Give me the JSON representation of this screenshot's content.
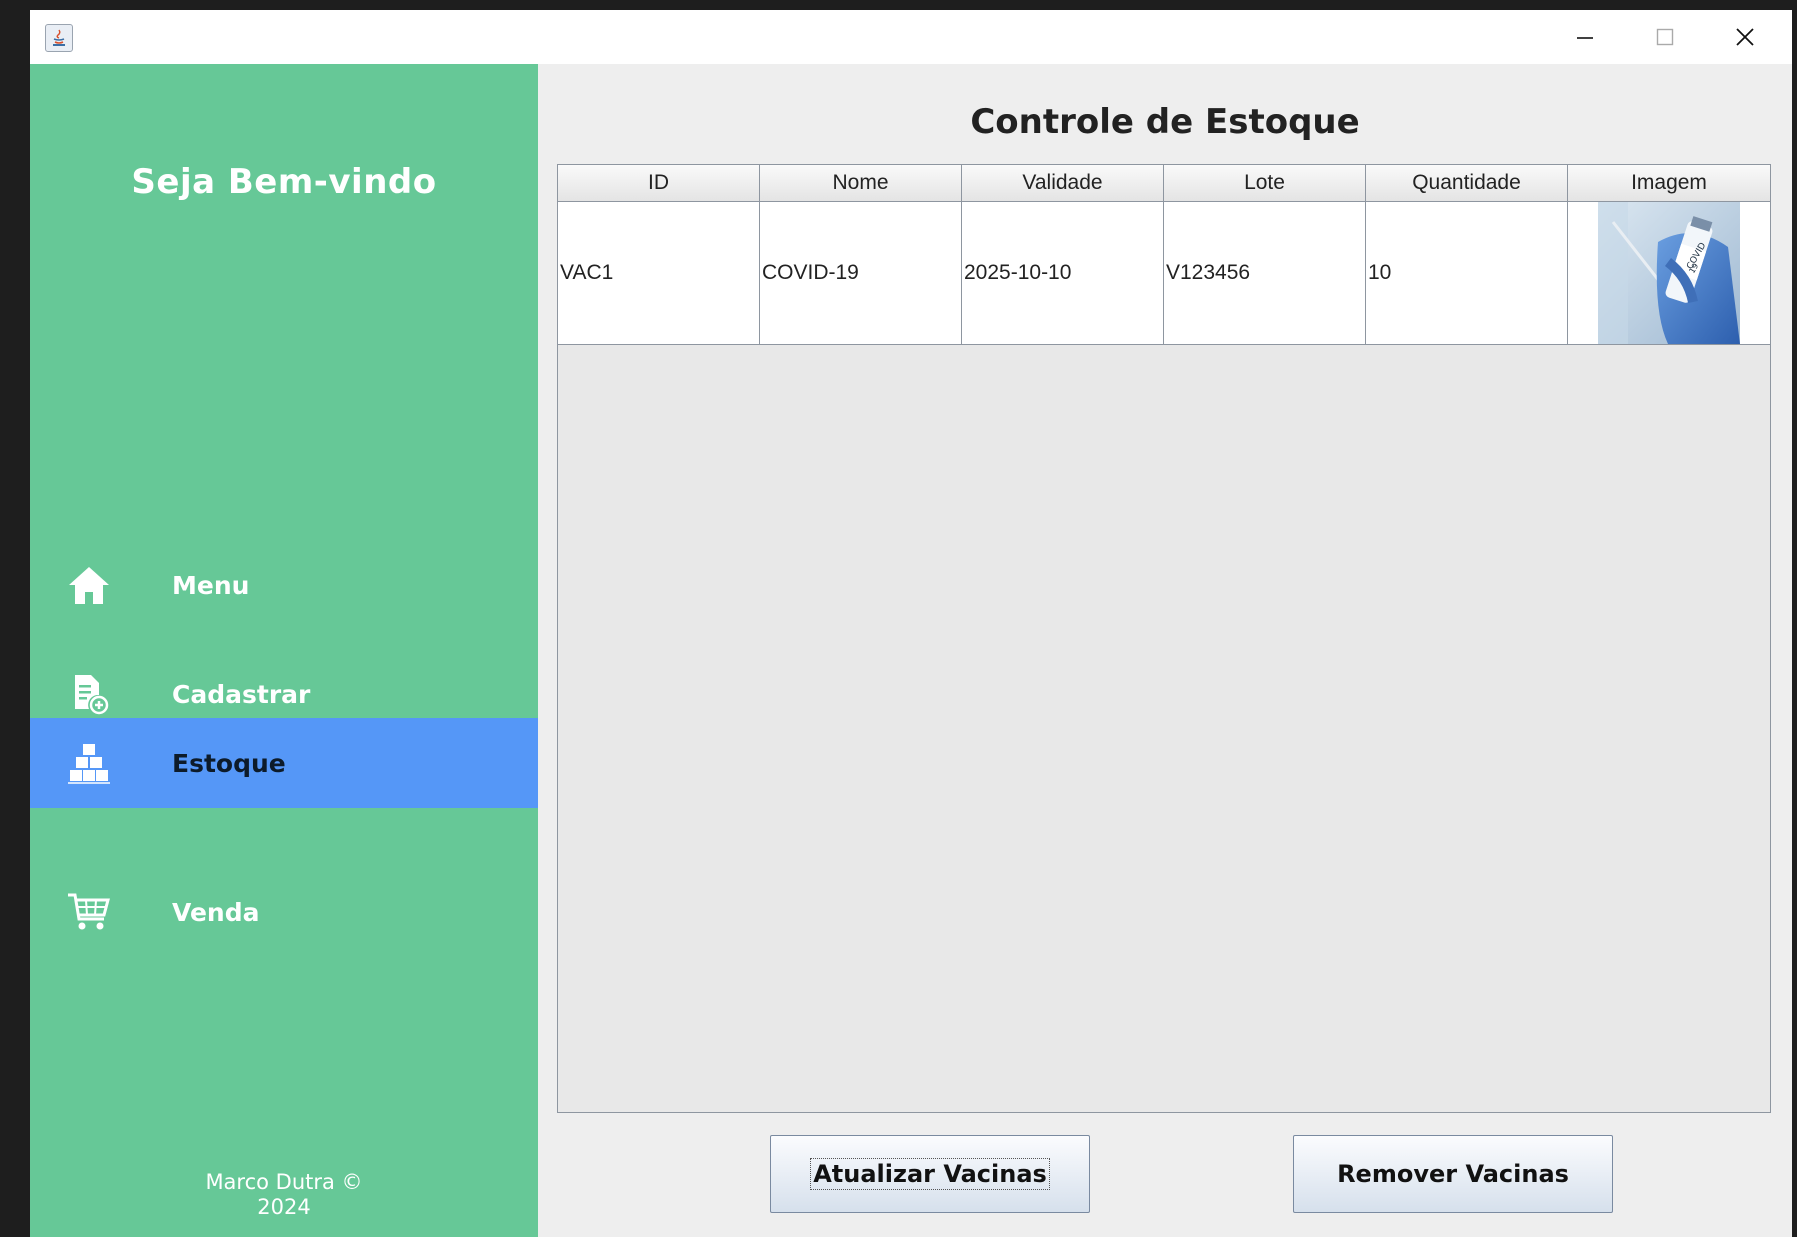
{
  "window": {
    "controls": [
      "minimize-icon",
      "maximize-icon",
      "close-icon"
    ]
  },
  "sidebar": {
    "welcome": "Seja Bem-vindo",
    "items": [
      {
        "label": "Menu",
        "icon": "home-icon"
      },
      {
        "label": "Cadastrar",
        "icon": "document-add-icon"
      },
      {
        "label": "Estoque",
        "icon": "stock-boxes-icon",
        "active": true
      },
      {
        "label": "Venda",
        "icon": "cart-icon"
      }
    ],
    "footer_line1": "Marco Dutra ©",
    "footer_line2": "2024"
  },
  "main": {
    "title": "Controle de Estoque",
    "table": {
      "columns": [
        "ID",
        "Nome",
        "Validade",
        "Lote",
        "Quantidade",
        "Imagem"
      ],
      "rows": [
        {
          "id": "VAC1",
          "nome": "COVID-19",
          "validade": "2025-10-10",
          "lote": "V123456",
          "quantidade": "10",
          "imagem": "vaccine-vial-image"
        }
      ]
    },
    "buttons": {
      "update": "Atualizar Vacinas",
      "remove": "Remover Vacinas"
    }
  },
  "colors": {
    "sidebar": "#66c897",
    "active_item": "#5597f7",
    "panel": "#eeeeee"
  }
}
